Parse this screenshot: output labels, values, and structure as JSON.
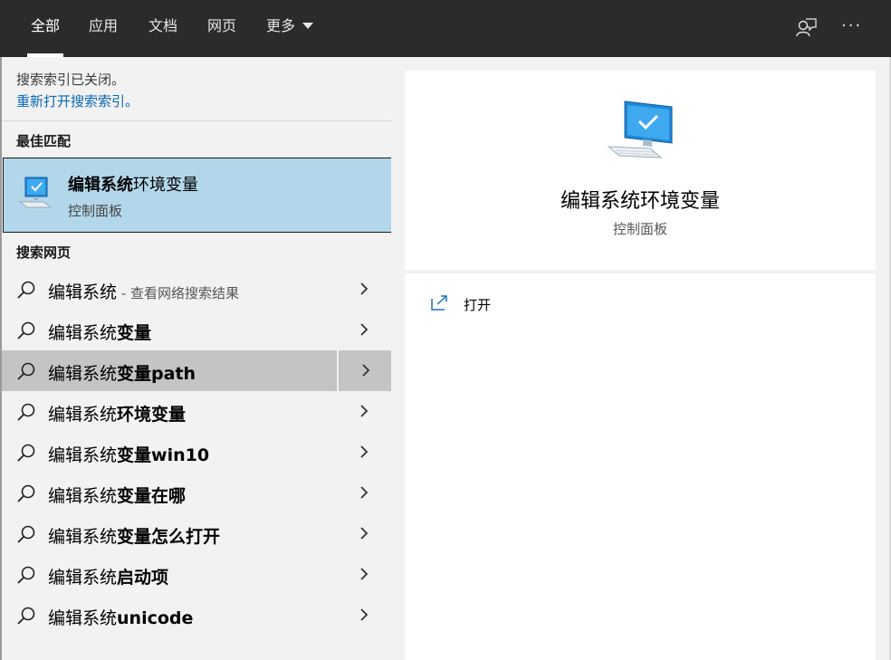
{
  "tabs": [
    {
      "label": "全部",
      "active": true
    },
    {
      "label": "应用"
    },
    {
      "label": "文档"
    },
    {
      "label": "网页"
    },
    {
      "label": "更多"
    }
  ],
  "top_icons": [
    "feedback-icon",
    "more-options-icon"
  ],
  "more_dots": "···",
  "index_notice": {
    "message": "搜索索引已关闭。",
    "link": "重新打开搜索索引。"
  },
  "best_match": {
    "section": "最佳匹配",
    "title_bold": "编辑系统",
    "title_rest": "环境变量",
    "subtitle": "控制面板",
    "icon": "computer-check-icon"
  },
  "web_search": {
    "section": "搜索网页",
    "items": [
      {
        "prefix": "编辑系统",
        "bold": "",
        "suffix": " - 查看网络搜索结果"
      },
      {
        "prefix": "编辑系统",
        "bold": "变量",
        "suffix": ""
      },
      {
        "prefix": "编辑系统",
        "bold": "变量path",
        "suffix": ""
      },
      {
        "prefix": "编辑系统",
        "bold": "环境变量",
        "suffix": ""
      },
      {
        "prefix": "编辑系统",
        "bold": "变量win10",
        "suffix": ""
      },
      {
        "prefix": "编辑系统",
        "bold": "变量在哪",
        "suffix": ""
      },
      {
        "prefix": "编辑系统",
        "bold": "变量怎么打开",
        "suffix": ""
      },
      {
        "prefix": "编辑系统",
        "bold": "启动项",
        "suffix": ""
      },
      {
        "prefix": "编辑系统",
        "bold": "unicode",
        "suffix": ""
      }
    ],
    "hovered_index": 2
  },
  "detail": {
    "title": "编辑系统环境变量",
    "subtitle": "控制面板",
    "icon": "computer-check-icon"
  },
  "actions": [
    {
      "label": "打开",
      "icon": "open-external-icon"
    }
  ],
  "colors": {
    "topbar": "#2b2b2b",
    "panel": "#f2f2f2",
    "selected": "#b3d7ea",
    "hover": "#c4c4c4",
    "link": "#0a68b4"
  }
}
